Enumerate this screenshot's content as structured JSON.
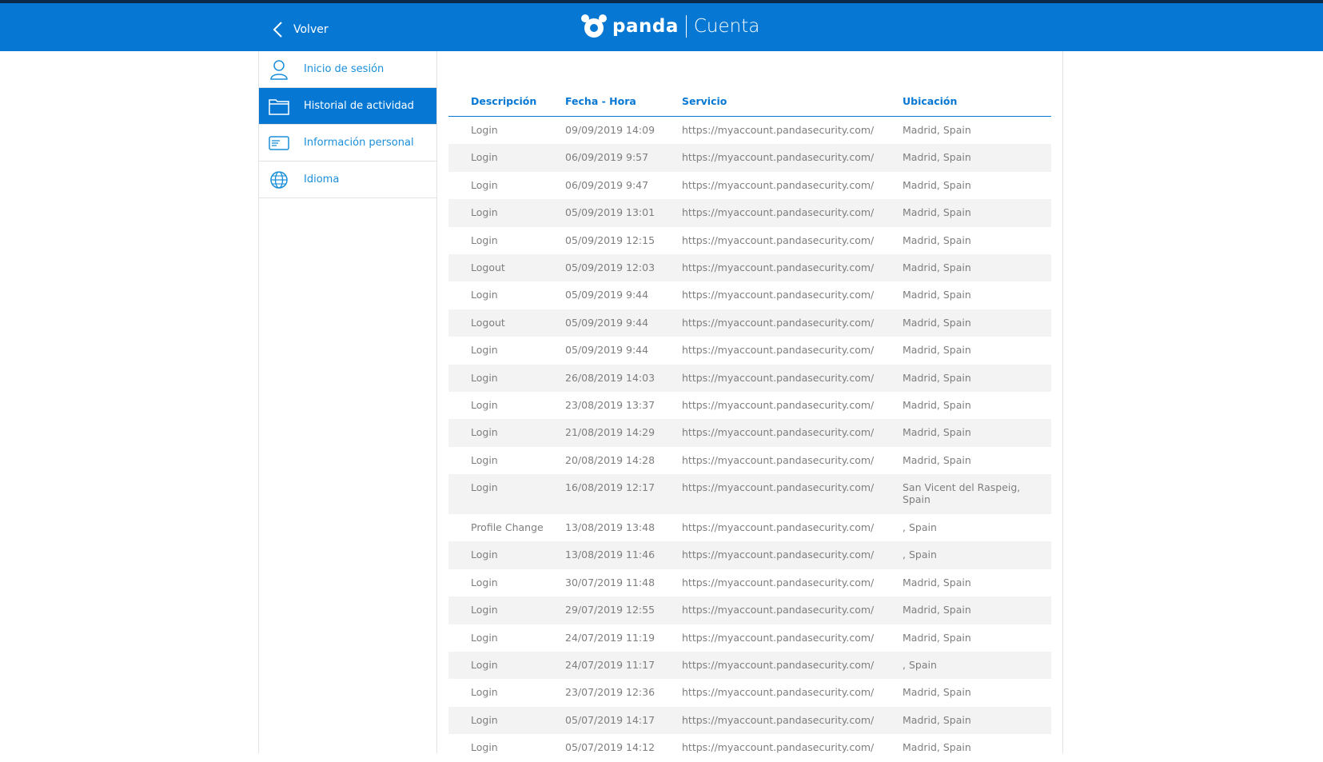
{
  "header": {
    "back_label": "Volver",
    "brand": "panda",
    "section": "Cuenta"
  },
  "sidebar": {
    "items": [
      {
        "label": "Inicio de sesión",
        "icon": "user-icon",
        "active": false
      },
      {
        "label": "Historial de actividad",
        "icon": "folder-icon",
        "active": true
      },
      {
        "label": "Información personal",
        "icon": "id-card-icon",
        "active": false
      },
      {
        "label": "Idioma",
        "icon": "globe-icon",
        "active": false
      }
    ]
  },
  "table": {
    "columns": [
      "Descripción",
      "Fecha - Hora",
      "Servicio",
      "Ubicación"
    ],
    "rows": [
      [
        "Login",
        "09/09/2019 14:09",
        "https://myaccount.pandasecurity.com/",
        "Madrid, Spain"
      ],
      [
        "Login",
        "06/09/2019 9:57",
        "https://myaccount.pandasecurity.com/",
        "Madrid, Spain"
      ],
      [
        "Login",
        "06/09/2019 9:47",
        "https://myaccount.pandasecurity.com/",
        "Madrid, Spain"
      ],
      [
        "Login",
        "05/09/2019 13:01",
        "https://myaccount.pandasecurity.com/",
        "Madrid, Spain"
      ],
      [
        "Login",
        "05/09/2019 12:15",
        "https://myaccount.pandasecurity.com/",
        "Madrid, Spain"
      ],
      [
        "Logout",
        "05/09/2019 12:03",
        "https://myaccount.pandasecurity.com/",
        "Madrid, Spain"
      ],
      [
        "Login",
        "05/09/2019 9:44",
        "https://myaccount.pandasecurity.com/",
        "Madrid, Spain"
      ],
      [
        "Logout",
        "05/09/2019 9:44",
        "https://myaccount.pandasecurity.com/",
        "Madrid, Spain"
      ],
      [
        "Login",
        "05/09/2019 9:44",
        "https://myaccount.pandasecurity.com/",
        "Madrid, Spain"
      ],
      [
        "Login",
        "26/08/2019 14:03",
        "https://myaccount.pandasecurity.com/",
        "Madrid, Spain"
      ],
      [
        "Login",
        "23/08/2019 13:37",
        "https://myaccount.pandasecurity.com/",
        "Madrid, Spain"
      ],
      [
        "Login",
        "21/08/2019 14:29",
        "https://myaccount.pandasecurity.com/",
        "Madrid, Spain"
      ],
      [
        "Login",
        "20/08/2019 14:28",
        "https://myaccount.pandasecurity.com/",
        "Madrid, Spain"
      ],
      [
        "Login",
        "16/08/2019 12:17",
        "https://myaccount.pandasecurity.com/",
        "San Vicent del Raspeig, Spain"
      ],
      [
        "Profile Change",
        "13/08/2019 13:48",
        "https://myaccount.pandasecurity.com/",
        ", Spain"
      ],
      [
        "Login",
        "13/08/2019 11:46",
        "https://myaccount.pandasecurity.com/",
        ", Spain"
      ],
      [
        "Login",
        "30/07/2019 11:48",
        "https://myaccount.pandasecurity.com/",
        "Madrid, Spain"
      ],
      [
        "Login",
        "29/07/2019 12:55",
        "https://myaccount.pandasecurity.com/",
        "Madrid, Spain"
      ],
      [
        "Login",
        "24/07/2019 11:19",
        "https://myaccount.pandasecurity.com/",
        "Madrid, Spain"
      ],
      [
        "Login",
        "24/07/2019 11:17",
        "https://myaccount.pandasecurity.com/",
        ", Spain"
      ],
      [
        "Login",
        "23/07/2019 12:36",
        "https://myaccount.pandasecurity.com/",
        "Madrid, Spain"
      ],
      [
        "Login",
        "05/07/2019 14:17",
        "https://myaccount.pandasecurity.com/",
        "Madrid, Spain"
      ],
      [
        "Login",
        "05/07/2019 14:12",
        "https://myaccount.pandasecurity.com/",
        "Madrid, Spain"
      ]
    ]
  },
  "colors": {
    "header_blue": "#0678d3",
    "link_blue": "#1a8fd9",
    "row_alt": "#f3f3f3",
    "text_gray": "#7e7e7e"
  }
}
